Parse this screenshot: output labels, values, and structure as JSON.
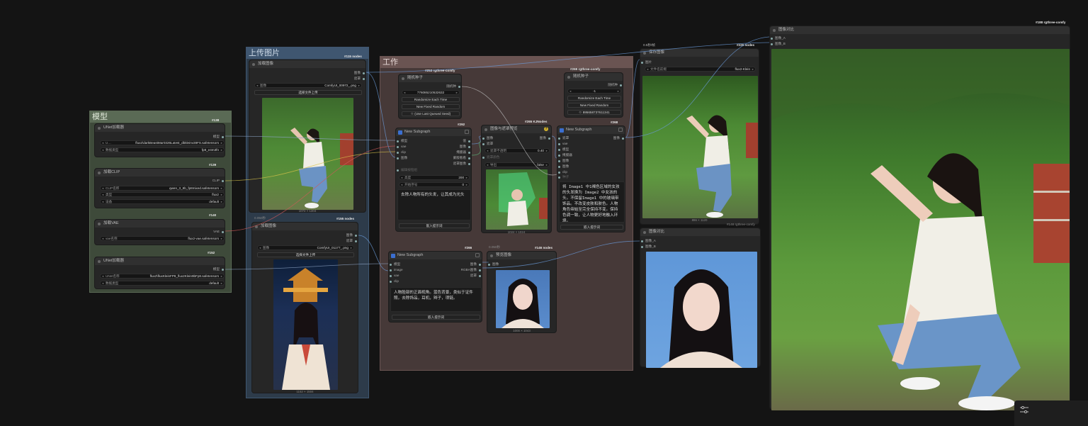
{
  "groups": {
    "model": {
      "title": "模型",
      "color": "#3e4a3a"
    },
    "upload": {
      "title": "上传图片",
      "color": "#2d3b4a",
      "badge": "#115 nodes"
    },
    "work": {
      "title": "工作",
      "color": "#463938"
    }
  },
  "nodes": {
    "unet1": {
      "title": "UNet加载器",
      "badge": "#138",
      "w1l": "U…",
      "w1v": "flux2\\darkBeastMar0326Latest_dbkleinv28FS.safetensors",
      "w2l": "数据类型",
      "w2v": "fp8_e4m3fn",
      "out": "模型"
    },
    "clip": {
      "title": "加载CLIP",
      "badge": "#139",
      "w1l": "CLIP名称",
      "w1v": "qwen_3_8b_fp8mixed.safetensors",
      "w2l": "类型",
      "w2v": "flux2",
      "w3l": "设备",
      "w3v": "default",
      "out": "CLIP"
    },
    "vae": {
      "title": "加载VAE",
      "badge": "#140",
      "w1l": "vae名称",
      "w1v": "flux2-vae.safetensors",
      "out": "VAE"
    },
    "unet2": {
      "title": "UNet加载器",
      "badge": "#152",
      "w1l": "UNet名称",
      "w1v": "flux2\\fluxKleinFP8_flux2Klein9bFp8.safetensors",
      "w2l": "数据类型",
      "w2v": "default",
      "out": "模型"
    },
    "loadimg1": {
      "title": "加载图像",
      "w1l": "图像",
      "w1v": "ComfyUI_00972_.png",
      "btn": "选择文件上传",
      "out1": "图像",
      "out2": "遮罩",
      "caption": "1072 × 1304"
    },
    "loadimg2": {
      "title": "加载图像",
      "badge": "#155 nodes",
      "time": "0.050秒",
      "w1l": "图像",
      "w1v": "ComfyUI_01177_.png",
      "btn": "选择文件上传",
      "out1": "图像",
      "out2": "遮罩",
      "caption": "1152 × 1504"
    },
    "seed1": {
      "title": "随机种子",
      "badge": "#253 rgthree-comfy",
      "out": "随机种",
      "value": "776085210532632",
      "b1": "Randomize Each Time",
      "b2": "New Fixed Random",
      "b3": "♲ (Use Last Queued Seed)"
    },
    "seed2": {
      "title": "随机种子",
      "badge": "#269 rgthree-comfy",
      "out": "随机种",
      "value": "-1",
      "b1": "Randomize Each Time",
      "b2": "New Fixed Random",
      "b3": "♲ 895658737611341"
    },
    "subgraph1": {
      "title": "New Subgraph",
      "badge": "#292",
      "in": [
        "模型",
        "vae",
        "clip",
        "图像"
      ],
      "out": [
        "值",
        "图像",
        "掩膜器",
        "蒙版看看",
        "遮罩图像"
      ],
      "disabled": "编辑按钮组",
      "w1l": "高度",
      "w1v": "200",
      "w2l": "开始序号",
      "w2v": "0",
      "text": "去除人物所有的头发，让其成为光头",
      "btn": "嵌入提示词"
    },
    "compare1": {
      "title": "图像与遮罩预览",
      "badge": "#265 KJNodes",
      "in": [
        "图像",
        "遮罩"
      ],
      "out": "图像",
      "w1l": "遮罩不透明",
      "w1v": "0.40",
      "w2l": "遮罩颜色",
      "w3l": "导出",
      "w3v": "false",
      "caption": "1024 × 1024"
    },
    "subgraph2": {
      "title": "New Subgraph",
      "badge": "#268",
      "in": [
        "遮罩",
        "vae",
        "模型",
        "掩膜器",
        "图像",
        "图像",
        "clip"
      ],
      "out": "图像",
      "disabled": "种子",
      "text": "将 Image1 中1褐色区域的女孩的头发换为 Image2 中女孩的头。不保留Image1 中的玻璃带饰品。不改变皮肤和肤色。人物角色帝始至完全保持不变。保持色调一致，让人物更好地融入环境。",
      "btn": "嵌入提示词"
    },
    "subgraph3": {
      "title": "New Subgraph",
      "badge": "#266",
      "in": [
        "模型",
        "image",
        "vae",
        "clip"
      ],
      "out": [
        "图像",
        "RGBA图像",
        "遮罩"
      ],
      "text": "人物脸部的正面视角。蓝色背景，类似于证件照。去除饰品，耳机，辫子，项链。",
      "btn": "嵌入提示词"
    },
    "preview": {
      "title": "预览图像",
      "badge": "#146 nodes",
      "time": "0.050秒",
      "in": "图像",
      "caption": "1000 × 1043"
    },
    "save": {
      "title": "保存图像",
      "badge": "#226 nodes",
      "header": "0.5秒/帧",
      "in": "图片",
      "w1l": "文件名前缀",
      "w1v": "flux2-Klein",
      "caption": "896 × 1120"
    },
    "compare2": {
      "title": "图像对比",
      "badge": "#148 rgthree-comfy",
      "in": [
        "图像_A",
        "图像_B"
      ]
    },
    "compare3": {
      "title": "图像对比",
      "badge": "#188 rgthree-comfy",
      "in": [
        "图像_A",
        "图像_B"
      ]
    }
  },
  "colors": {
    "canvas": "#141414",
    "node": "#262626",
    "title": "#303030",
    "badge": "#e8e8e8"
  },
  "icons": {
    "settings": "sliders-icon",
    "subgraph": "subgraph-icon",
    "help": "question-icon"
  }
}
